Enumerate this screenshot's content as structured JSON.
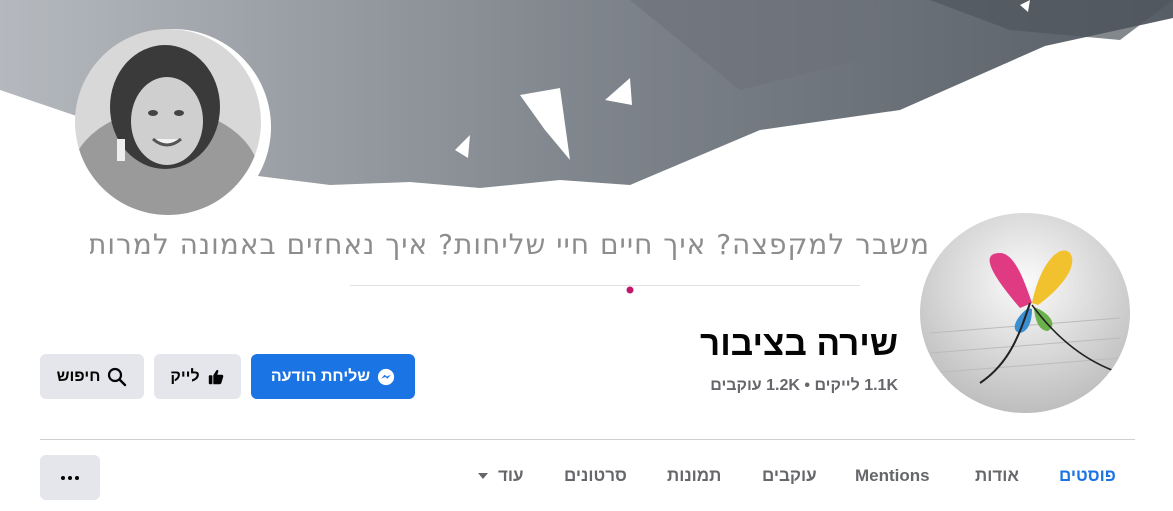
{
  "cover": {
    "tagline": "משבר למקפצה? איך חיים חיי שליחות? איך נאחזים באמונה למרות הכל?"
  },
  "page": {
    "name": "שירה בציבור",
    "likes": "1.1K לייקים",
    "separator": "•",
    "followers": "1.2K עוקבים"
  },
  "actions": {
    "message_label": "שליחת הודעה",
    "like_label": "לייק",
    "search_label": "חיפוש"
  },
  "tabs": [
    {
      "label": "פוסטים",
      "active": true
    },
    {
      "label": "אודות"
    },
    {
      "label": "Mentions"
    },
    {
      "label": "עוקבים"
    },
    {
      "label": "תמונות"
    },
    {
      "label": "סרטונים"
    },
    {
      "label": "עוד"
    }
  ],
  "colors": {
    "accent": "#1b74e4",
    "secondary_button": "#e4e6eb",
    "muted_text": "#65676b"
  },
  "icons": {
    "message": "messenger-icon",
    "like": "thumbs-up-icon",
    "search": "search-icon",
    "more_tab": "caret-down-icon",
    "overflow": "more-dots-icon"
  }
}
